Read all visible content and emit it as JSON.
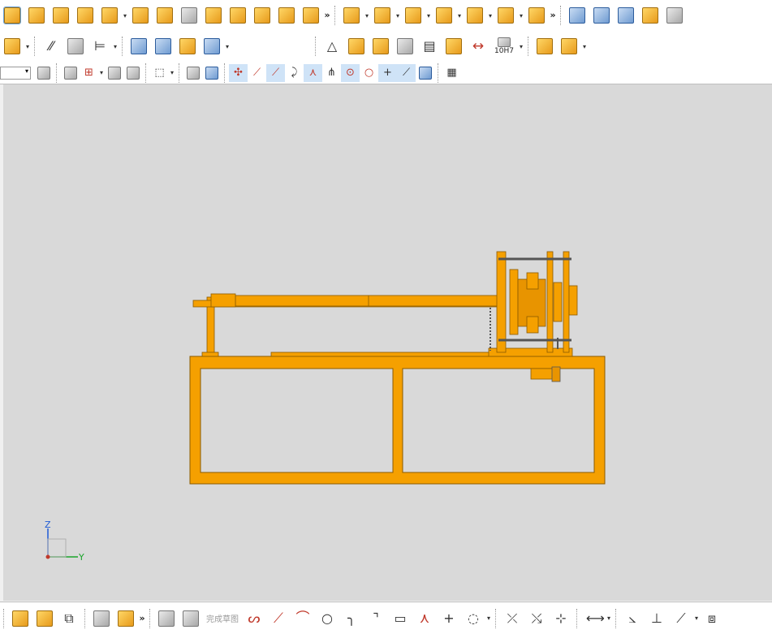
{
  "toolbar1": {
    "groups": [
      {
        "name": "sketch-feature-tools",
        "icons": [
          "sketch-icon",
          "extrude-icon",
          "pattern-icon",
          "shell-icon",
          "sketch-point-icon"
        ]
      },
      {
        "name": "body-tools",
        "icons": [
          "block-icon",
          "sweep-icon",
          "boolean-icon",
          "fillet-icon",
          "cylinder-icon"
        ]
      },
      {
        "name": "surface-tools",
        "icons": [
          "offset-face-icon",
          "trim-body-icon",
          "draft-icon"
        ]
      },
      {
        "name": "assembly-tools",
        "icons": [
          "add-component-icon",
          "constraint-icon",
          "remove-icon",
          "replace-icon",
          "mirror-assembly-icon",
          "exploded-view-icon",
          "wave-geometry-icon"
        ]
      },
      {
        "name": "freeform-tools",
        "icons": [
          "ruled-surface-icon",
          "mesh-surface-icon",
          "swept-surface-icon",
          "studio-surface-icon",
          "wrap-icon"
        ]
      }
    ]
  },
  "toolbar2": {
    "groups": [
      {
        "name": "pmi-tools",
        "icons": [
          "abc-annotation-icon",
          "section-line-icon",
          "section-curve-icon",
          "flag-note-icon"
        ]
      },
      {
        "name": "design-tools",
        "icons": [
          "gear-icon",
          "spring-icon",
          "bearing-icon",
          "harness-icon"
        ]
      },
      {
        "name": "drafting-tools",
        "icons": [
          "triangle-icon",
          "table-icon",
          "grid-icon",
          "part-list-icon",
          "note-icon",
          "paint-icon",
          "dimension-icon",
          "fit-icon"
        ]
      },
      {
        "name": "analysis-tools",
        "icons": [
          "assembly-check-icon",
          "clearance-icon"
        ]
      }
    ],
    "fit_label": "10H7"
  },
  "toolbar3": {
    "filter_value": "",
    "icons": [
      "selection-filter-icon",
      "snap-off-icon",
      "select-feature-icon",
      "select-curve-icon",
      "select-point-icon",
      "rectangle-select-icon",
      "section-view-icon",
      "shaded-body-icon",
      "snap-point-icon",
      "endpoint-icon",
      "midpoint-icon",
      "control-point-icon",
      "intersection-icon",
      "arc-center-icon",
      "quadrant-icon",
      "point-on-curve-icon",
      "tangent-icon",
      "mesh-select-icon"
    ]
  },
  "bottombar": {
    "finish_sketch_label": "完成草图",
    "icons": [
      "assembly-navigator-icon",
      "parts-icon",
      "constraint-browser-icon",
      "model-tree-icon",
      "link-icon",
      "sketch-finish-icon",
      "profile-icon",
      "line-icon",
      "arc-icon",
      "circle-icon",
      "fillet-curve-icon",
      "chamfer-curve-icon",
      "rectangle-icon",
      "polygon-icon",
      "point-icon",
      "offset-curve-icon",
      "trim-icon",
      "extend-icon",
      "make-corner-icon",
      "mirror-curve-icon",
      "geometric-constraint-icon",
      "dimension-constraint-icon",
      "show-constraints-icon",
      "view-sketch-icon"
    ]
  },
  "viewport": {
    "background_color": "#d9d9d9",
    "model_color": "#f5a000",
    "model_name": "",
    "triad": {
      "z_label": "Z",
      "y_label": "Y"
    }
  }
}
